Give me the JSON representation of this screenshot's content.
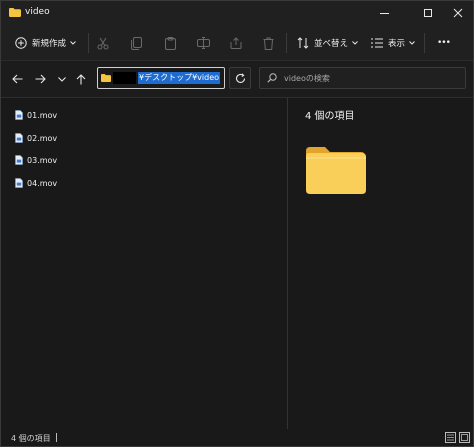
{
  "window": {
    "title": "video",
    "minimize_icon": "minimize-icon",
    "maximize_icon": "maximize-icon",
    "close_icon": "close-icon"
  },
  "toolbar": {
    "new_label": "新規作成",
    "sort_label": "並べ替え",
    "view_label": "表示",
    "more_label": "•••"
  },
  "navigation": {
    "back_icon": "arrow-left-icon",
    "forward_icon": "arrow-right-icon",
    "recent_icon": "chevron-down-icon",
    "up_icon": "arrow-up-icon"
  },
  "address": {
    "selected_path": "¥デスクトップ¥video"
  },
  "search": {
    "placeholder": "videoの検索"
  },
  "files": [
    {
      "name": "01.mov"
    },
    {
      "name": "02.mov"
    },
    {
      "name": "03.mov"
    },
    {
      "name": "04.mov"
    }
  ],
  "details": {
    "item_count": "4 個の項目"
  },
  "status": {
    "item_count": "4 個の項目"
  },
  "colors": {
    "background": "#191919",
    "chrome": "#202020",
    "folder_yellow": "#f5c542",
    "selection_blue": "#1f6cd1"
  }
}
